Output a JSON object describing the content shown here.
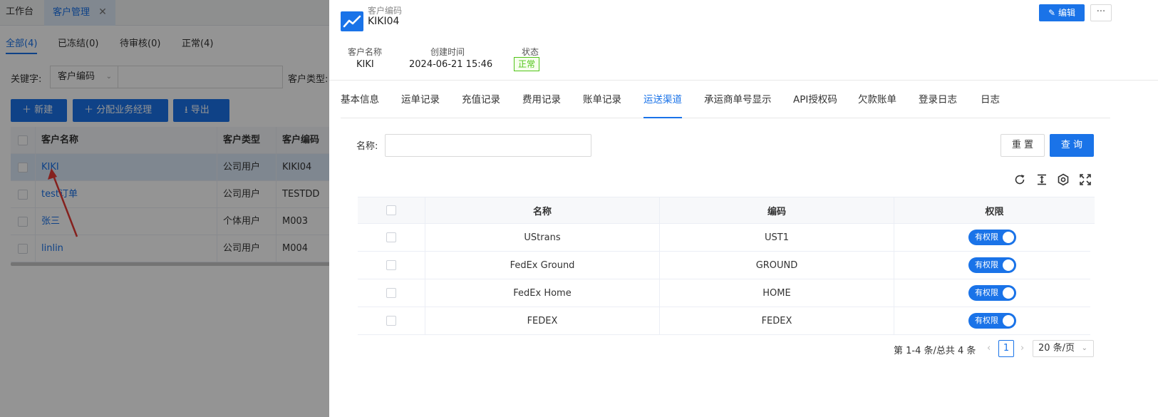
{
  "background": {
    "tabs": [
      {
        "label": "工作台"
      },
      {
        "label": "客户管理",
        "close": "✕"
      }
    ],
    "status_tabs": [
      "全部(4)",
      "已冻结(0)",
      "待审核(0)",
      "正常(4)"
    ],
    "filter": {
      "keyword_label": "关键字:",
      "keyword_select": "客户编码",
      "type_label": "客户类型:"
    },
    "buttons": {
      "new": "新建",
      "assign": "分配业务经理",
      "export": "导出"
    },
    "table": {
      "headers": [
        "客户名称",
        "客户类型",
        "客户编码"
      ],
      "rows": [
        {
          "name": "KIKI",
          "type": "公司用户",
          "code": "KIKI04"
        },
        {
          "name": "test订单",
          "type": "公司用户",
          "code": "TESTDD"
        },
        {
          "name": "张三",
          "type": "个体用户",
          "code": "M003"
        },
        {
          "name": "linlin",
          "type": "公司用户",
          "code": "M004"
        }
      ]
    }
  },
  "drawer": {
    "header": {
      "code_label": "客户编码",
      "code_value": "KIKI04",
      "edit_label": "编辑",
      "more_label": "···"
    },
    "info": {
      "name_label": "客户名称",
      "name_value": "KIKI",
      "created_label": "创建时间",
      "created_value": "2024-06-21 15:46",
      "status_label": "状态",
      "status_value": "正常"
    },
    "tabs": [
      "基本信息",
      "运单记录",
      "充值记录",
      "费用记录",
      "账单记录",
      "运送渠道",
      "承运商单号显示",
      "API授权码",
      "欠款账单",
      "登录日志",
      "日志"
    ],
    "active_tab": "运送渠道",
    "query": {
      "name_label": "名称:",
      "name_value": "",
      "reset_label": "重 置",
      "query_label": "查 询"
    },
    "toolbar_icons": [
      "refresh-icon",
      "column-height-icon",
      "settings-icon",
      "fullscreen-icon"
    ],
    "table": {
      "headers": [
        "名称",
        "编码",
        "权限"
      ],
      "rows": [
        {
          "name": "UStrans",
          "code": "UST1",
          "permission": "有权限"
        },
        {
          "name": "FedEx Ground",
          "code": "GROUND",
          "permission": "有权限"
        },
        {
          "name": "FedEx Home",
          "code": "HOME",
          "permission": "有权限"
        },
        {
          "name": "FEDEX",
          "code": "FEDEX",
          "permission": "有权限"
        }
      ]
    },
    "pagination": {
      "summary": "第 1-4 条/总共 4 条",
      "current_page": "1",
      "page_size": "20 条/页"
    }
  },
  "colors": {
    "accent": "#1a73e8",
    "status_green": "#52c41a",
    "annotation_arrow": "#e53935"
  }
}
